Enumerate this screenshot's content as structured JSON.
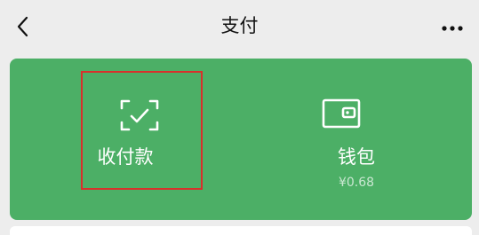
{
  "header": {
    "title": "支付",
    "back_icon": "chevron-left-icon",
    "more_icon": "more-horizontal-icon"
  },
  "card": {
    "background_color": "#4caf66",
    "actions": [
      {
        "label": "收付款",
        "icon": "scan-check-icon"
      },
      {
        "label": "钱包",
        "icon": "wallet-icon",
        "balance": "¥0.68"
      }
    ]
  },
  "highlight_color": "#d9302b"
}
